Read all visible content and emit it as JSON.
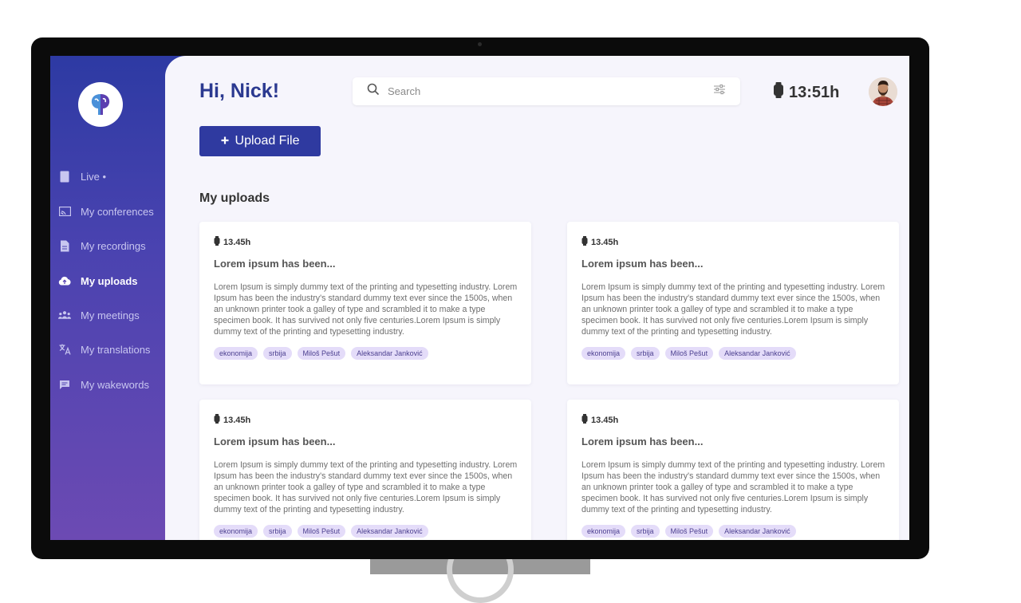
{
  "sidebar": {
    "items": [
      {
        "label": "Live •",
        "icon": "document-icon",
        "active": false
      },
      {
        "label": "My conferences",
        "icon": "cast-icon",
        "active": false
      },
      {
        "label": "My recordings",
        "icon": "file-icon",
        "active": false
      },
      {
        "label": "My uploads",
        "icon": "cloud-upload-icon",
        "active": true
      },
      {
        "label": "My meetings",
        "icon": "people-icon",
        "active": false
      },
      {
        "label": "My translations",
        "icon": "translate-icon",
        "active": false
      },
      {
        "label": "My wakewords",
        "icon": "chat-icon",
        "active": false
      }
    ]
  },
  "header": {
    "greeting": "Hi, Nick!",
    "search_placeholder": "Search",
    "timer": "13:51h"
  },
  "upload_button": {
    "label": "Upload File"
  },
  "uploads": {
    "section_title": "My uploads",
    "cards": [
      {
        "time": "13.45h",
        "title": "Lorem ipsum has been...",
        "body": "Lorem Ipsum is simply dummy text of the printing and typesetting industry. Lorem Ipsum has been the industry's standard dummy text ever since the 1500s, when an unknown printer took a galley of type and scrambled it to make a type specimen book. It has survived not only five centuries.Lorem Ipsum is simply dummy text of the printing and typesetting industry.",
        "tags": [
          "ekonomija",
          "srbija",
          "Miloš Pešut",
          "Aleksandar Janković"
        ]
      },
      {
        "time": "13.45h",
        "title": "Lorem ipsum has been...",
        "body": "Lorem Ipsum is simply dummy text of the printing and typesetting industry. Lorem Ipsum has been the industry's standard dummy text ever since the 1500s, when an unknown printer took a galley of type and scrambled it to make a type specimen book. It has survived not only five centuries.Lorem Ipsum is simply dummy text of the printing and typesetting industry.",
        "tags": [
          "ekonomija",
          "srbija",
          "Miloš Pešut",
          "Aleksandar Janković"
        ]
      },
      {
        "time": "13.45h",
        "title": "Lorem ipsum has been...",
        "body": "Lorem Ipsum is simply dummy text of the printing and typesetting industry. Lorem Ipsum has been the industry's standard dummy text ever since the 1500s, when an unknown printer took a galley of type and scrambled it to make a type specimen book. It has survived not only five centuries.Lorem Ipsum is simply dummy text of the printing and typesetting industry.",
        "tags": [
          "ekonomija",
          "srbija",
          "Miloš Pešut",
          "Aleksandar Janković"
        ]
      },
      {
        "time": "13.45h",
        "title": "Lorem ipsum has been...",
        "body": "Lorem Ipsum is simply dummy text of the printing and typesetting industry. Lorem Ipsum has been the industry's standard dummy text ever since the 1500s, when an unknown printer took a galley of type and scrambled it to make a type specimen book. It has survived not only five centuries.Lorem Ipsum is simply dummy text of the printing and typesetting industry.",
        "tags": [
          "ekonomija",
          "srbija",
          "Miloš Pešut",
          "Aleksandar Janković"
        ]
      }
    ]
  },
  "colors": {
    "sidebar_top": "#2d3aa3",
    "sidebar_bottom": "#6c4ab3",
    "accent": "#2f3aa0",
    "tag_bg": "#e4dcf9",
    "main_bg": "#f6f5fc"
  }
}
